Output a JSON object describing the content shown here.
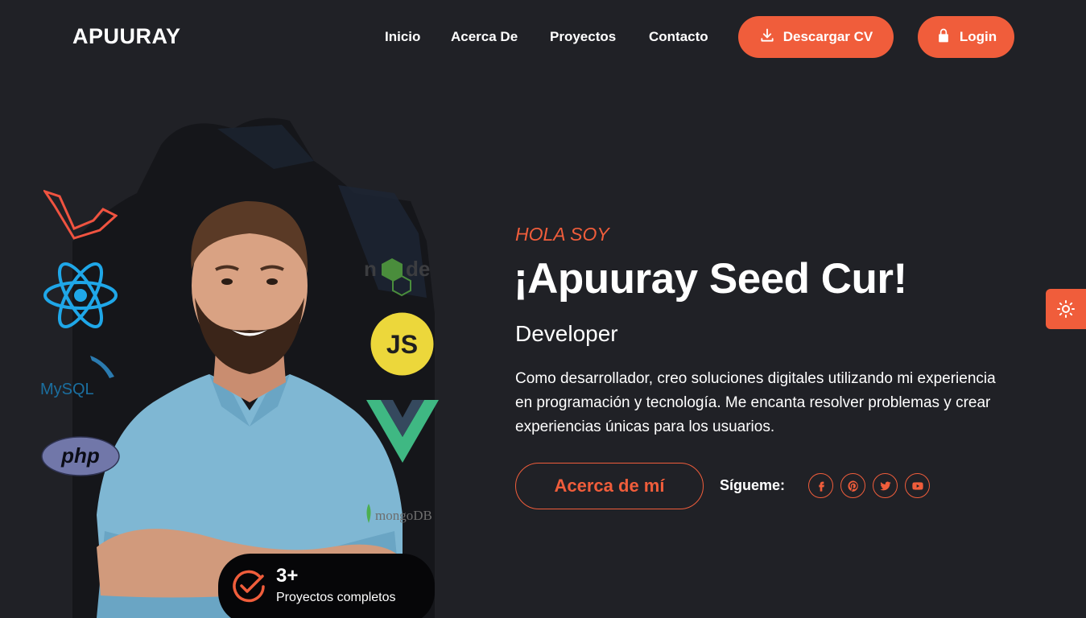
{
  "brand": {
    "logo": "APUURAY"
  },
  "nav": {
    "items": [
      {
        "label": "Inicio"
      },
      {
        "label": "Acerca De"
      },
      {
        "label": "Proyectos"
      },
      {
        "label": "Contacto"
      }
    ],
    "download_cv": "Descargar CV",
    "login": "Login"
  },
  "hero": {
    "greeting": "HOLA SOY",
    "name": "¡Apuuray Seed Cur!",
    "role": "Developer",
    "description": "Como desarrollador, creo soluciones digitales utilizando mi experiencia en programación y tecnología. Me encanta resolver problemas y crear experiencias únicas para los usuarios.",
    "about_button": "Acerca de mí",
    "follow_label": "Sígueme:",
    "socials": [
      "facebook-icon",
      "pinterest-icon",
      "twitter-icon",
      "youtube-icon"
    ]
  },
  "tech_logos": {
    "mysql": "MySQL",
    "php": "php",
    "js": "JS",
    "mongodb": "mongoDB"
  },
  "stats": {
    "count": "3+",
    "label": "Proyectos completos"
  },
  "colors": {
    "background": "#202126",
    "accent": "#f05d3b"
  }
}
